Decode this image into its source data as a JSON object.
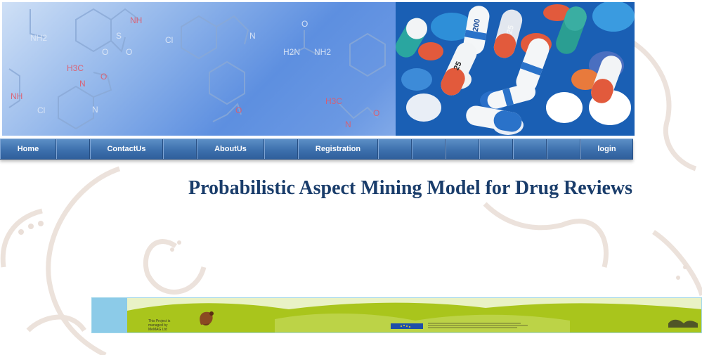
{
  "nav": {
    "home": "Home",
    "contact": "ContactUs",
    "about": "AboutUs",
    "registration": "Registration",
    "login": "login"
  },
  "page": {
    "title": "Probabilistic Aspect Mining Model for Drug Reviews"
  },
  "banner": {
    "chem_labels": [
      "NH2",
      "NH",
      "S",
      "O",
      "O",
      "Cl",
      "N",
      "H2N",
      "NH2",
      "O",
      "H3C",
      "N",
      "O",
      "NH",
      "Cl",
      "N",
      "O",
      "H3C",
      "N",
      "O"
    ],
    "pill_labels": [
      "200",
      "25",
      "25"
    ]
  },
  "footer": {
    "managed_line1": "This Project is",
    "managed_line2": "managed by",
    "managed_line3": "MeMAG Ltd"
  },
  "colors": {
    "nav_bg": "#3d70ad",
    "title": "#1a3d6b",
    "footer_green": "#a9c51c"
  }
}
